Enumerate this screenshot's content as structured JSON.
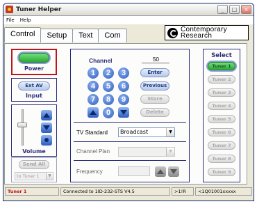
{
  "window": {
    "title": "Tuner Helper",
    "minimize": "_",
    "maximize": "□",
    "close": "×"
  },
  "menu": [
    "File",
    "Help"
  ],
  "tabs": [
    "Control",
    "Setup",
    "Text",
    "Com"
  ],
  "logo": {
    "line1": "Contemporary",
    "line2": "Research"
  },
  "left": {
    "power_label": "Power",
    "input_value": "Ext AV",
    "input_label": "Input",
    "volume_label": "Volume",
    "send_all": "Send All",
    "send_target": "to Tuner 1"
  },
  "center": {
    "channel_label": "Channel",
    "channel_value": "50",
    "keypad": [
      "1",
      "2",
      "3",
      "4",
      "5",
      "6",
      "7",
      "8",
      "9",
      "0"
    ],
    "enter": "Enter",
    "previous": "Previous",
    "store": "Store",
    "delete": "Delete",
    "tv_standard_label": "TV Standard",
    "tv_standard_value": "Broadcast",
    "channel_plan_label": "Channel Plan",
    "frequency_label": "Frequency"
  },
  "select": {
    "title": "Select",
    "tuners": [
      "Tuner 1",
      "Tuner 2",
      "Tuner 3",
      "Tuner 4",
      "Tuner 5",
      "Tuner 6",
      "Tuner 7",
      "Tuner 8",
      "Tuner 9"
    ]
  },
  "status": {
    "tuner": "Tuner 1",
    "connection": "Connected to 1ID-232-STS V4.5",
    "code": ">1!R",
    "reply": "<1Q01001xxxxx"
  }
}
